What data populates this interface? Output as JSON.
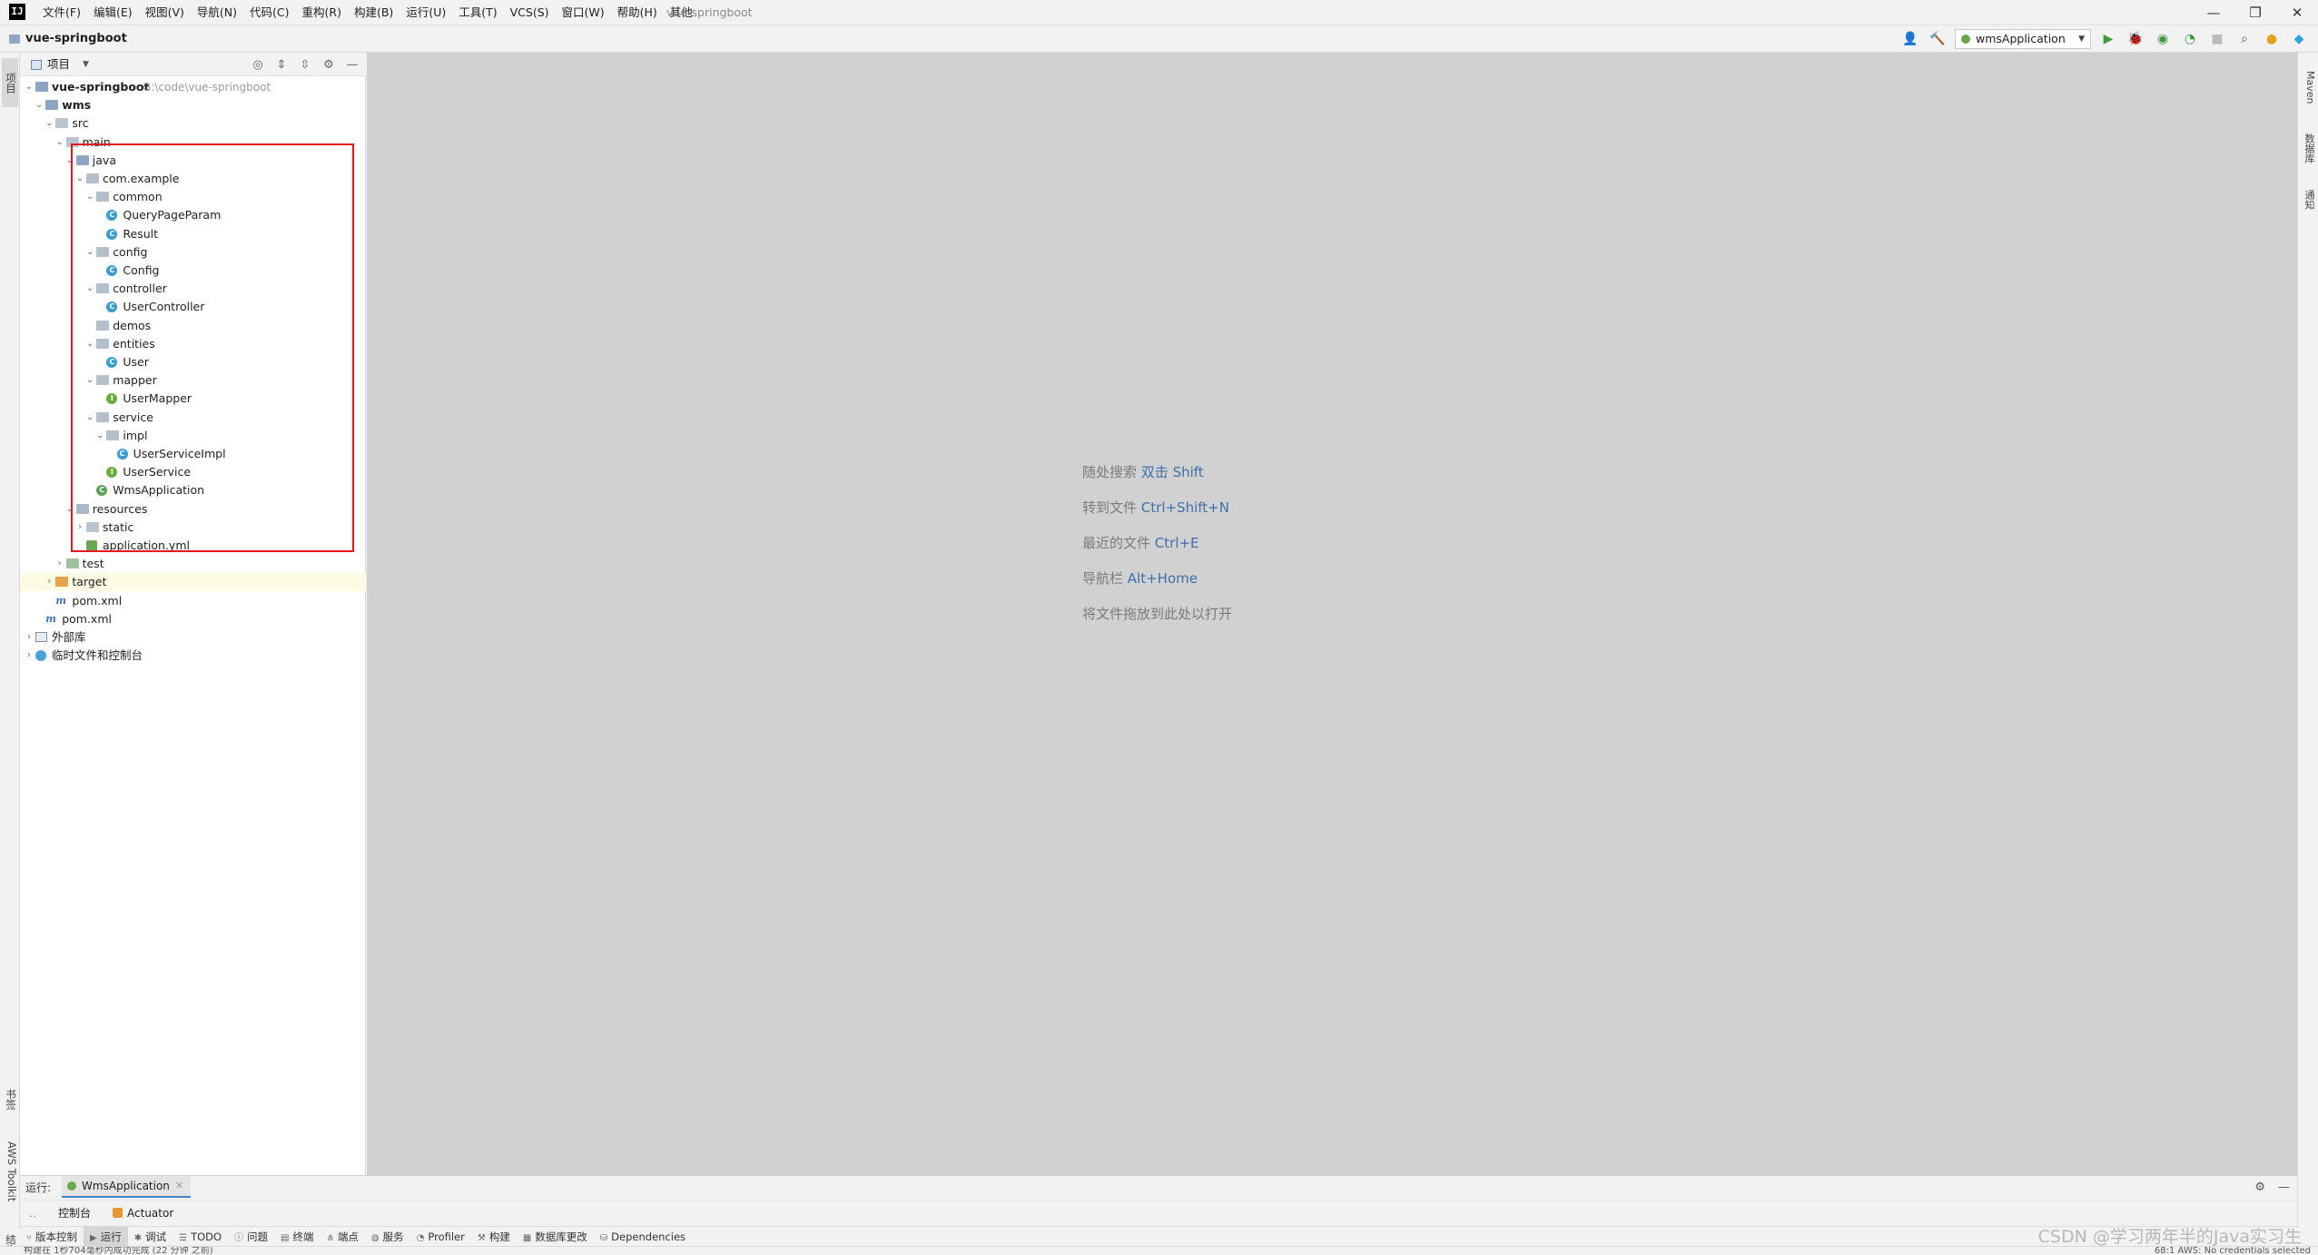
{
  "window": {
    "logo": "IJ",
    "menu": [
      "文件(F)",
      "编辑(E)",
      "视图(V)",
      "导航(N)",
      "代码(C)",
      "重构(R)",
      "构建(B)",
      "运行(U)",
      "工具(T)",
      "VCS(S)",
      "窗口(W)",
      "帮助(H)",
      "其他"
    ],
    "title": "vue-springboot",
    "controls": [
      "—",
      "❐",
      "✕"
    ]
  },
  "navbar": {
    "breadcrumb": "vue-springboot",
    "run_config": "wmsApplication"
  },
  "left_stripe": {
    "project_tab": "项目",
    "bookmarks_tab": "书签",
    "aws_tab": "AWS Toolkit",
    "structure_tab": "结构"
  },
  "right_stripe": {
    "maven_tab": "Maven",
    "database_tab": "数据库",
    "notifications_tab": "通知"
  },
  "project_panel": {
    "title": "项目",
    "root_path": "G:\\code\\vue-springboot"
  },
  "tree": [
    {
      "label": "vue-springboot",
      "depth": 0,
      "icon": "module",
      "expanded": true
    },
    {
      "label": "wms",
      "depth": 1,
      "icon": "module",
      "expanded": true
    },
    {
      "label": "src",
      "depth": 2,
      "icon": "folder",
      "expanded": true
    },
    {
      "label": "main",
      "depth": 3,
      "icon": "folder",
      "expanded": true
    },
    {
      "label": "java",
      "depth": 4,
      "icon": "src",
      "expanded": true
    },
    {
      "label": "com.example",
      "depth": 5,
      "icon": "package",
      "expanded": true
    },
    {
      "label": "common",
      "depth": 6,
      "icon": "package",
      "expanded": true
    },
    {
      "label": "QueryPageParam",
      "depth": 7,
      "icon": "class"
    },
    {
      "label": "Result",
      "depth": 7,
      "icon": "class"
    },
    {
      "label": "config",
      "depth": 6,
      "icon": "package",
      "expanded": true
    },
    {
      "label": "Config",
      "depth": 7,
      "icon": "class"
    },
    {
      "label": "controller",
      "depth": 6,
      "icon": "package",
      "expanded": true
    },
    {
      "label": "UserController",
      "depth": 7,
      "icon": "class"
    },
    {
      "label": "demos",
      "depth": 6,
      "icon": "package"
    },
    {
      "label": "entities",
      "depth": 6,
      "icon": "package",
      "expanded": true
    },
    {
      "label": "User",
      "depth": 7,
      "icon": "class"
    },
    {
      "label": "mapper",
      "depth": 6,
      "icon": "package",
      "expanded": true
    },
    {
      "label": "UserMapper",
      "depth": 7,
      "icon": "interface"
    },
    {
      "label": "service",
      "depth": 6,
      "icon": "package",
      "expanded": true
    },
    {
      "label": "impl",
      "depth": 7,
      "icon": "package",
      "expanded": true
    },
    {
      "label": "UserServiceImpl",
      "depth": 8,
      "icon": "class"
    },
    {
      "label": "UserService",
      "depth": 7,
      "icon": "interface"
    },
    {
      "label": "WmsApplication",
      "depth": 6,
      "icon": "spring"
    },
    {
      "label": "resources",
      "depth": 4,
      "icon": "resources",
      "expanded": true
    },
    {
      "label": "static",
      "depth": 5,
      "icon": "folder",
      "expanded": false
    },
    {
      "label": "application.yml",
      "depth": 5,
      "icon": "yml"
    },
    {
      "label": "test",
      "depth": 3,
      "icon": "test",
      "expanded": false
    },
    {
      "label": "target",
      "depth": 2,
      "icon": "orange",
      "expanded": false,
      "highlight": true
    },
    {
      "label": "pom.xml",
      "depth": 2,
      "icon": "maven"
    },
    {
      "label": "pom.xml",
      "depth": 1,
      "icon": "maven"
    },
    {
      "label": "外部库",
      "depth": 0,
      "icon": "library",
      "expanded": false
    },
    {
      "label": "临时文件和控制台",
      "depth": 0,
      "icon": "scratch",
      "expanded": false
    }
  ],
  "editor_hints": [
    {
      "text": "随处搜索",
      "key": "双击 Shift"
    },
    {
      "text": "转到文件",
      "key": "Ctrl+Shift+N"
    },
    {
      "text": "最近的文件",
      "key": "Ctrl+E"
    },
    {
      "text": "导航栏",
      "key": "Alt+Home"
    },
    {
      "text": "将文件拖放到此处以打开",
      "key": ""
    }
  ],
  "run_window": {
    "label": "运行:",
    "tab": "WmsApplication",
    "subtabs": [
      "控制台",
      "Actuator"
    ]
  },
  "bottom_tools": [
    "版本控制",
    "运行",
    "调试",
    "TODO",
    "问题",
    "终端",
    "端点",
    "服务",
    "Profiler",
    "构建",
    "数据库更改",
    "Dependencies"
  ],
  "status": {
    "message": "构建在 1秒704毫秒内成功完成 (22 分钟 之前)",
    "right": "68:1   AWS: No credentials selected"
  },
  "watermark": "CSDN @学习两年半的Java实习生",
  "colors": {
    "accent": "#4083c9",
    "highlight_box": "#e5161d",
    "hint_key": "#3f6ea8",
    "editor_bg": "#d1d1d1"
  }
}
